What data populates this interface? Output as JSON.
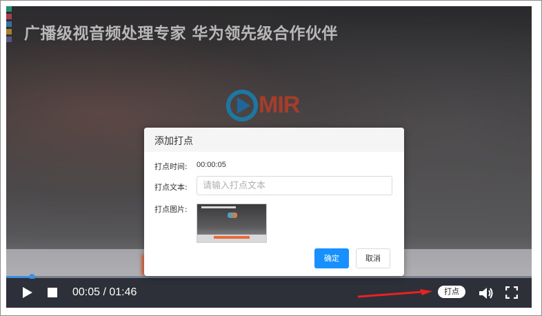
{
  "video": {
    "title": "广播级视音频处理专家 华为领先级合作伙伴",
    "logo_text": "MIR",
    "strip_colors": [
      "#39c6a0",
      "#e8557a",
      "#4a9de0",
      "#e3b53c",
      "#7a7fb0"
    ]
  },
  "player": {
    "time_text": "00:05 / 01:46",
    "progress": 0.048,
    "mark_button_label": "打点",
    "play_icon": "play-icon",
    "stop_icon": "stop-icon",
    "volume_icon": "volume-icon",
    "fullscreen_icon": "fullscreen-icon"
  },
  "dialog": {
    "title": "添加打点",
    "time_label": "打点时间:",
    "time_value": "00:00:05",
    "text_label": "打点文本:",
    "text_placeholder": "请输入打点文本",
    "text_value": "",
    "image_label": "打点图片:",
    "confirm_label": "确定",
    "cancel_label": "取消"
  },
  "colors": {
    "accent": "#1890ff",
    "progress": "#3a8ee6",
    "annotation_arrow": "#e8231f",
    "controls_bg": "#2d3038"
  }
}
